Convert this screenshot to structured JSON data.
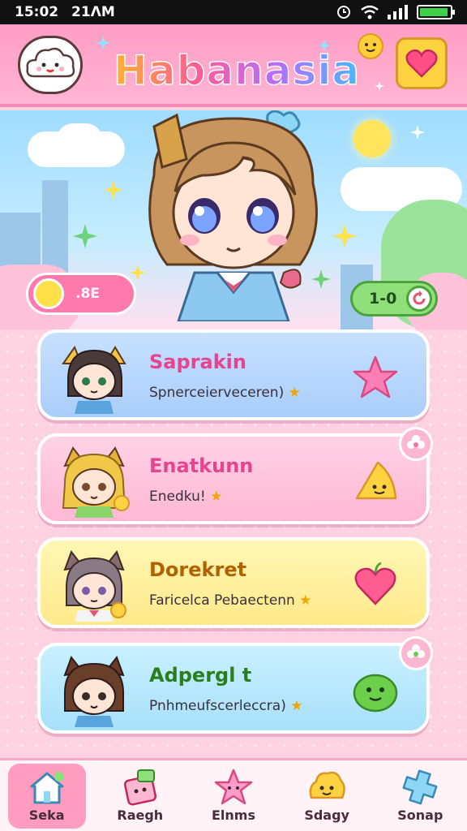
{
  "status_bar": {
    "time": "15:02",
    "period": "21ΛM"
  },
  "header": {
    "title": "Habanasia"
  },
  "scene": {
    "coin_value": ".8E",
    "counter_value": "1-0"
  },
  "cards": [
    {
      "name": "Saprakin",
      "subtitle": "Spnerceierveceren)"
    },
    {
      "name": "Enatkunn",
      "subtitle": "Enedku!"
    },
    {
      "name": "Dorekret",
      "subtitle": "Faricelca Pebaectenn"
    },
    {
      "name": "Adpergl t",
      "subtitle": "Pnhmeufscerleccra)"
    }
  ],
  "bottom_nav": [
    {
      "label": "Seka",
      "icon": "home-icon"
    },
    {
      "label": "Raegh",
      "icon": "pencil-box-icon"
    },
    {
      "label": "Elnms",
      "icon": "pink-star-icon"
    },
    {
      "label": "Sdagy",
      "icon": "yellow-blob-icon"
    },
    {
      "label": "Sonap",
      "icon": "blue-cross-icon"
    }
  ],
  "colors": {
    "header_pink": "#ff9cc5",
    "accent_yellow": "#ffd23f",
    "card_blue": "#a9cdfa",
    "card_pink": "#ffb8d3",
    "card_yellow": "#ffe98a",
    "card_cyan": "#a8e0fb"
  }
}
